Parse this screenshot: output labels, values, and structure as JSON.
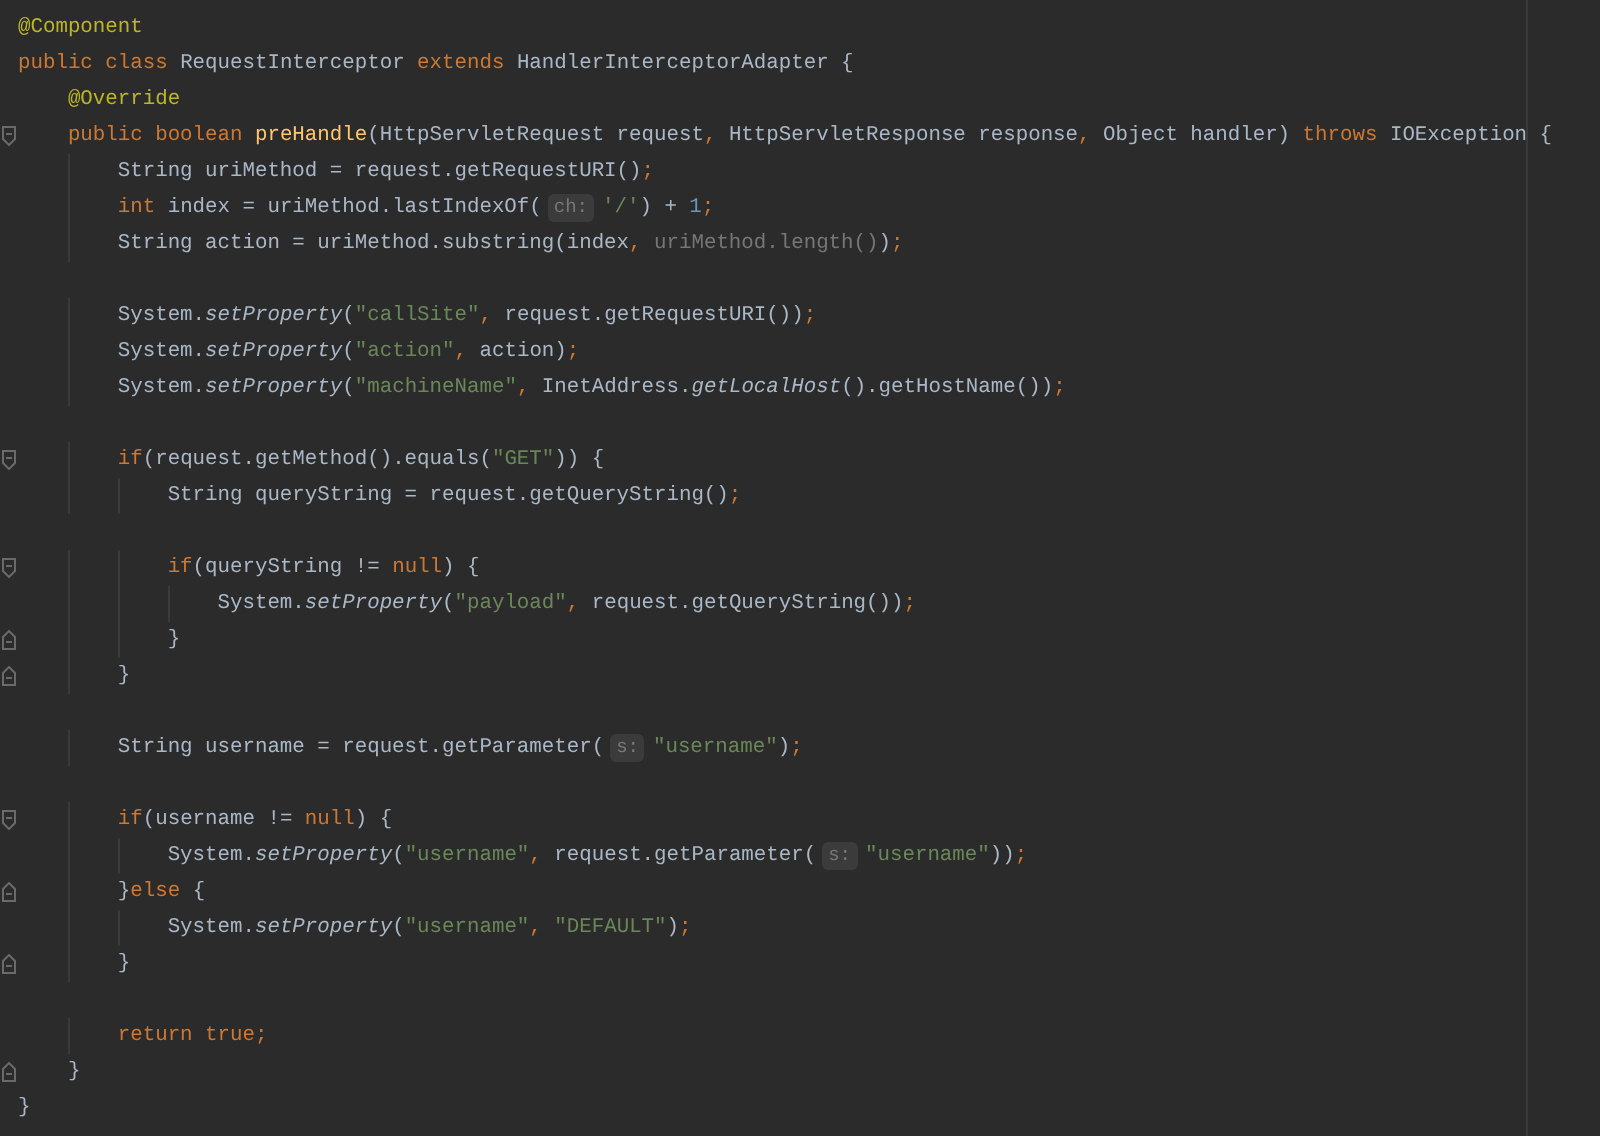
{
  "editor": {
    "lines": [
      {
        "kind": "code",
        "tokens": [
          {
            "kind": "annotation",
            "text": "@Component"
          }
        ]
      },
      {
        "kind": "code",
        "tokens": [
          {
            "kind": "keyword",
            "text": "public class "
          },
          {
            "kind": "plain",
            "text": "RequestInterceptor "
          },
          {
            "kind": "keyword",
            "text": "extends "
          },
          {
            "kind": "plain",
            "text": "HandlerInterceptorAdapter {"
          }
        ]
      },
      {
        "kind": "code",
        "tokens": [
          {
            "kind": "annotation",
            "text": "    @Override"
          }
        ]
      },
      {
        "kind": "block-start",
        "tokens": [
          {
            "kind": "keyword",
            "text": "    public boolean "
          },
          {
            "kind": "method",
            "text": "preHandle"
          },
          {
            "kind": "plain",
            "text": "(HttpServletRequest request"
          },
          {
            "kind": "keyword",
            "text": ", "
          },
          {
            "kind": "plain",
            "text": "HttpServletResponse response"
          },
          {
            "kind": "keyword",
            "text": ", "
          },
          {
            "kind": "plain",
            "text": "Object handler) "
          },
          {
            "kind": "keyword",
            "text": "throws "
          },
          {
            "kind": "plain",
            "text": "IOException {"
          }
        ]
      },
      {
        "kind": "code",
        "tokens": [
          {
            "kind": "plain",
            "text": "        String uriMethod = request.getRequestURI()"
          },
          {
            "kind": "keyword",
            "text": ";"
          }
        ]
      },
      {
        "kind": "code",
        "tokens": [
          {
            "kind": "keyword",
            "text": "        int "
          },
          {
            "kind": "plain",
            "text": "index = uriMethod.lastIndexOf("
          },
          {
            "kind": "hint",
            "text": "ch:"
          },
          {
            "kind": "string",
            "text": "'/'"
          },
          {
            "kind": "plain",
            "text": ") + "
          },
          {
            "kind": "number",
            "text": "1"
          },
          {
            "kind": "keyword",
            "text": ";"
          }
        ]
      },
      {
        "kind": "code",
        "tokens": [
          {
            "kind": "plain",
            "text": "        String action = uriMethod.substring(index"
          },
          {
            "kind": "keyword",
            "text": ", "
          },
          {
            "kind": "dim",
            "text": "uriMethod.length()"
          },
          {
            "kind": "plain",
            "text": ")"
          },
          {
            "kind": "keyword",
            "text": ";"
          }
        ]
      },
      {
        "kind": "blank"
      },
      {
        "kind": "code",
        "tokens": [
          {
            "kind": "plain",
            "text": "        System."
          },
          {
            "kind": "static",
            "text": "setProperty"
          },
          {
            "kind": "plain",
            "text": "("
          },
          {
            "kind": "string",
            "text": "\"callSite\""
          },
          {
            "kind": "keyword",
            "text": ", "
          },
          {
            "kind": "plain",
            "text": "request.getRequestURI())"
          },
          {
            "kind": "keyword",
            "text": ";"
          }
        ]
      },
      {
        "kind": "code",
        "tokens": [
          {
            "kind": "plain",
            "text": "        System."
          },
          {
            "kind": "static",
            "text": "setProperty"
          },
          {
            "kind": "plain",
            "text": "("
          },
          {
            "kind": "string",
            "text": "\"action\""
          },
          {
            "kind": "keyword",
            "text": ", "
          },
          {
            "kind": "plain",
            "text": "action)"
          },
          {
            "kind": "keyword",
            "text": ";"
          }
        ]
      },
      {
        "kind": "code",
        "tokens": [
          {
            "kind": "plain",
            "text": "        System."
          },
          {
            "kind": "static",
            "text": "setProperty"
          },
          {
            "kind": "plain",
            "text": "("
          },
          {
            "kind": "string",
            "text": "\"machineName\""
          },
          {
            "kind": "keyword",
            "text": ", "
          },
          {
            "kind": "plain",
            "text": "InetAddress."
          },
          {
            "kind": "static",
            "text": "getLocalHost"
          },
          {
            "kind": "plain",
            "text": "().getHostName())"
          },
          {
            "kind": "keyword",
            "text": ";"
          }
        ]
      },
      {
        "kind": "blank"
      },
      {
        "kind": "block-start",
        "tokens": [
          {
            "kind": "keyword",
            "text": "        if"
          },
          {
            "kind": "plain",
            "text": "(request.getMethod().equals("
          },
          {
            "kind": "string",
            "text": "\"GET\""
          },
          {
            "kind": "plain",
            "text": ")) {"
          }
        ]
      },
      {
        "kind": "code",
        "tokens": [
          {
            "kind": "plain",
            "text": "            String queryString = request.getQueryString()"
          },
          {
            "kind": "keyword",
            "text": ";"
          }
        ]
      },
      {
        "kind": "blank"
      },
      {
        "kind": "block-start",
        "tokens": [
          {
            "kind": "keyword",
            "text": "            if"
          },
          {
            "kind": "plain",
            "text": "(queryString != "
          },
          {
            "kind": "keyword",
            "text": "null"
          },
          {
            "kind": "plain",
            "text": ") {"
          }
        ]
      },
      {
        "kind": "code",
        "tokens": [
          {
            "kind": "plain",
            "text": "                System."
          },
          {
            "kind": "static",
            "text": "setProperty"
          },
          {
            "kind": "plain",
            "text": "("
          },
          {
            "kind": "string",
            "text": "\"payload\""
          },
          {
            "kind": "keyword",
            "text": ", "
          },
          {
            "kind": "plain",
            "text": "request.getQueryString())"
          },
          {
            "kind": "keyword",
            "text": ";"
          }
        ]
      },
      {
        "kind": "block-end",
        "tokens": [
          {
            "kind": "plain",
            "text": "            }"
          }
        ]
      },
      {
        "kind": "block-end",
        "tokens": [
          {
            "kind": "plain",
            "text": "        }"
          }
        ]
      },
      {
        "kind": "blank"
      },
      {
        "kind": "code",
        "tokens": [
          {
            "kind": "plain",
            "text": "        String username = request.getParameter("
          },
          {
            "kind": "hint",
            "text": "s:"
          },
          {
            "kind": "string",
            "text": "\"username\""
          },
          {
            "kind": "plain",
            "text": ")"
          },
          {
            "kind": "keyword",
            "text": ";"
          }
        ]
      },
      {
        "kind": "blank"
      },
      {
        "kind": "block-start",
        "tokens": [
          {
            "kind": "keyword",
            "text": "        if"
          },
          {
            "kind": "plain",
            "text": "(username != "
          },
          {
            "kind": "keyword",
            "text": "null"
          },
          {
            "kind": "plain",
            "text": ") {"
          }
        ]
      },
      {
        "kind": "code",
        "tokens": [
          {
            "kind": "plain",
            "text": "            System."
          },
          {
            "kind": "static",
            "text": "setProperty"
          },
          {
            "kind": "plain",
            "text": "("
          },
          {
            "kind": "string",
            "text": "\"username\""
          },
          {
            "kind": "keyword",
            "text": ", "
          },
          {
            "kind": "plain",
            "text": "request.getParameter("
          },
          {
            "kind": "hint",
            "text": "s:"
          },
          {
            "kind": "string",
            "text": "\"username\""
          },
          {
            "kind": "plain",
            "text": "))"
          },
          {
            "kind": "keyword",
            "text": ";"
          }
        ]
      },
      {
        "kind": "block-end",
        "tokens": [
          {
            "kind": "plain",
            "text": "        }"
          },
          {
            "kind": "keyword",
            "text": "else "
          },
          {
            "kind": "plain",
            "text": "{"
          }
        ]
      },
      {
        "kind": "code",
        "tokens": [
          {
            "kind": "plain",
            "text": "            System."
          },
          {
            "kind": "static",
            "text": "setProperty"
          },
          {
            "kind": "plain",
            "text": "("
          },
          {
            "kind": "string",
            "text": "\"username\""
          },
          {
            "kind": "keyword",
            "text": ", "
          },
          {
            "kind": "string",
            "text": "\"DEFAULT\""
          },
          {
            "kind": "plain",
            "text": ")"
          },
          {
            "kind": "keyword",
            "text": ";"
          }
        ]
      },
      {
        "kind": "block-end",
        "tokens": [
          {
            "kind": "plain",
            "text": "        }"
          }
        ]
      },
      {
        "kind": "blank"
      },
      {
        "kind": "code",
        "tokens": [
          {
            "kind": "keyword",
            "text": "        return true;"
          }
        ]
      },
      {
        "kind": "block-end",
        "tokens": [
          {
            "kind": "plain",
            "text": "    }"
          }
        ]
      },
      {
        "kind": "code",
        "tokens": [
          {
            "kind": "plain",
            "text": "}"
          }
        ]
      }
    ]
  }
}
